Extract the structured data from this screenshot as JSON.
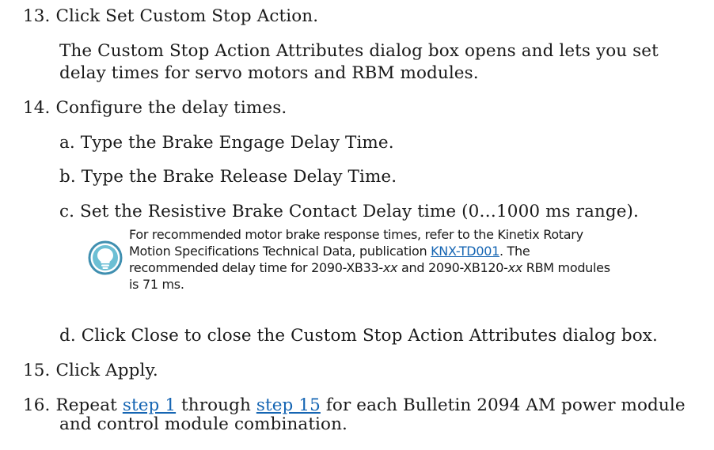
{
  "steps": [
    {
      "number": "13.",
      "text": "Click Set Custom Stop Action.",
      "detail_line1": "The Custom Stop Action Attributes dialog box opens and lets you set",
      "detail_line2": "delay times for servo motors and RBM modules."
    },
    {
      "number": "14.",
      "text": "Configure the delay times.",
      "substeps": [
        {
          "text": "a. Type the Brake Engage Delay Time."
        },
        {
          "text": "b. Type the Brake Release Delay Time."
        },
        {
          "text": "c. Set the Resistive Brake Contact Delay time (0…1000 ms range)."
        },
        {
          "text": "d. Click Close to close the Custom Stop Action Attributes dialog box."
        }
      ]
    },
    {
      "number": "15.",
      "text": "Click Apply."
    },
    {
      "number": "16.",
      "text_before_link1": "Repeat ",
      "link1": "step 1",
      "text_between": " through ",
      "link2": "step 15",
      "text_after": " for each Bulletin 2094 AM power module",
      "text_line2": "and control module combination."
    }
  ],
  "tip": {
    "icon": "lightbulb-icon",
    "line1": "For recommended motor brake response times, refer to the Kinetix Rotary",
    "line2_before": "Motion Specifications Technical Data, publication ",
    "line2_link": "KNX-TD001",
    "line2_after": ". The",
    "line3_before": "recommended delay time for 2090-XB33-",
    "line3_xx1": "xx",
    "line3_mid": " and 2090-XB120-",
    "line3_xx2": "xx",
    "line3_after": " RBM modules",
    "line4": "is 71 ms."
  },
  "colors": {
    "link": "#1565b3",
    "icon_fill": "#6cbfd4",
    "icon_ring": "#3f8fb0"
  }
}
